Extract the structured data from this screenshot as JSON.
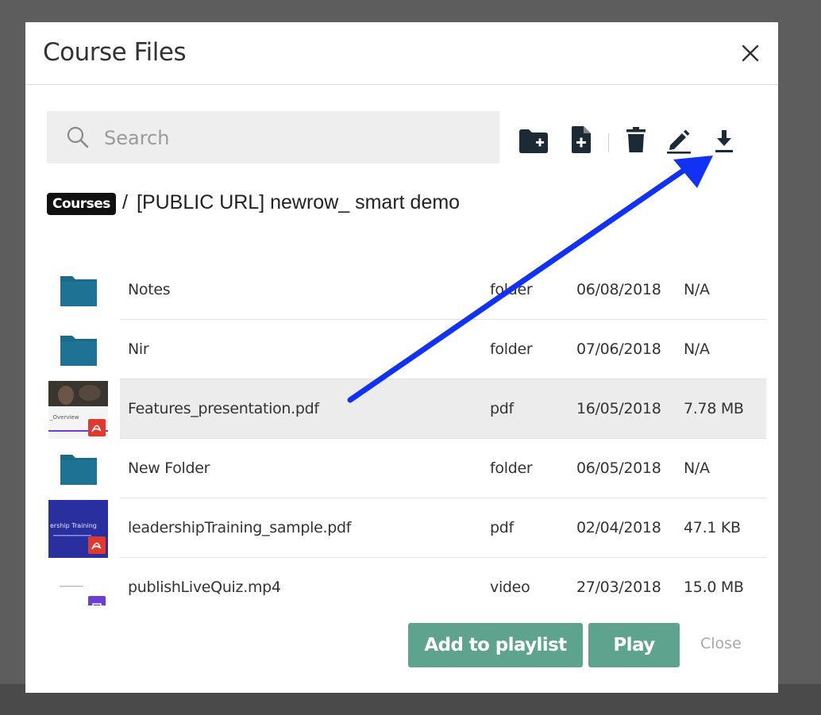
{
  "dialog": {
    "title": "Course Files",
    "close_label": "Close"
  },
  "search": {
    "placeholder": "Search"
  },
  "toolbar": {
    "buttons": [
      {
        "icon": "new-folder-icon"
      },
      {
        "icon": "new-file-icon"
      },
      {
        "icon": "trash-icon"
      },
      {
        "icon": "edit-icon"
      },
      {
        "icon": "download-icon"
      }
    ]
  },
  "breadcrumb": {
    "root": "Courses",
    "separator": "/",
    "current": "[PUBLIC URL] newrow_ smart demo"
  },
  "files": [
    {
      "name": "Notes",
      "type": "folder",
      "date": "06/08/2018",
      "size": "N/A",
      "thumb": "folder",
      "selected": false
    },
    {
      "name": "Nir",
      "type": "folder",
      "date": "07/06/2018",
      "size": "N/A",
      "thumb": "folder",
      "selected": false
    },
    {
      "name": "Features_presentation.pdf",
      "type": "pdf",
      "date": "16/05/2018",
      "size": "7.78 MB",
      "thumb": "pdf-features",
      "selected": true
    },
    {
      "name": "New Folder",
      "type": "folder",
      "date": "06/05/2018",
      "size": "N/A",
      "thumb": "folder",
      "selected": false
    },
    {
      "name": "leadershipTraining_sample.pdf",
      "type": "pdf",
      "date": "02/04/2018",
      "size": "47.1 KB",
      "thumb": "pdf-leadership",
      "selected": false
    },
    {
      "name": "publishLiveQuiz.mp4",
      "type": "video",
      "date": "27/03/2018",
      "size": "15.0 MB",
      "thumb": "video",
      "selected": false
    }
  ],
  "thumb_text": {
    "features_caption": "_Overview",
    "leadership_caption": "ership Training"
  },
  "actions": {
    "add_to_playlist": "Add to playlist",
    "play": "Play",
    "close": "Close"
  },
  "colors": {
    "folder": "#1a6a8a",
    "primary_button": "#5ea38d",
    "annotation_arrow": "#1132f5",
    "pdf_badge": "#e2392f",
    "video_badge": "#6b3fd4"
  }
}
